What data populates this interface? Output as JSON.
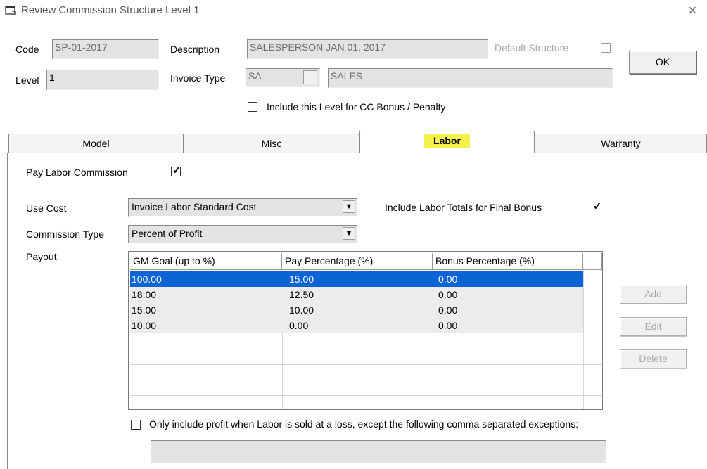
{
  "window": {
    "title": "Review Commission Structure Level  1",
    "close_glyph": "×"
  },
  "header": {
    "code_label": "Code",
    "code_value": "SP-01-2017",
    "description_label": "Description",
    "description_value": "SALESPERSON JAN 01, 2017",
    "default_structure_label": "Default Structure",
    "level_label": "Level",
    "level_value": "1",
    "invoice_type_label": "Invoice Type",
    "invoice_type_code": "SA",
    "invoice_type_name": "SALES",
    "cc_bonus_label": "Include this Level for CC Bonus / Penalty",
    "ok_label": "OK"
  },
  "tabs": [
    {
      "label": "Model",
      "active": false
    },
    {
      "label": "Misc",
      "active": false
    },
    {
      "label": "Labor",
      "active": true
    },
    {
      "label": "Warranty",
      "active": false
    }
  ],
  "labor": {
    "pay_labor_label": "Pay Labor Commission",
    "use_cost_label": "Use Cost",
    "use_cost_value": "Invoice Labor Standard Cost",
    "include_totals_label": "Include Labor Totals for Final Bonus",
    "commission_type_label": "Commission Type",
    "commission_type_value": "Percent of Profit",
    "payout_label": "Payout",
    "columns": [
      "GM Goal (up to %)",
      "Pay Percentage (%)",
      "Bonus Percentage (%)"
    ],
    "rows": [
      [
        "100.00",
        "15.00",
        "0.00"
      ],
      [
        "18.00",
        "12.50",
        "0.00"
      ],
      [
        "15.00",
        "10.00",
        "0.00"
      ],
      [
        "10.00",
        "0.00",
        "0.00"
      ]
    ],
    "add_label": "Add",
    "edit_label": "Edit",
    "delete_label": "Delete",
    "loss_label": "Only include profit when Labor is sold at a loss, except the following comma separated exceptions:",
    "exceptions_value": ""
  },
  "colors": {
    "selection": "#0a64d6",
    "tab_highlight": "#f6f04a"
  }
}
